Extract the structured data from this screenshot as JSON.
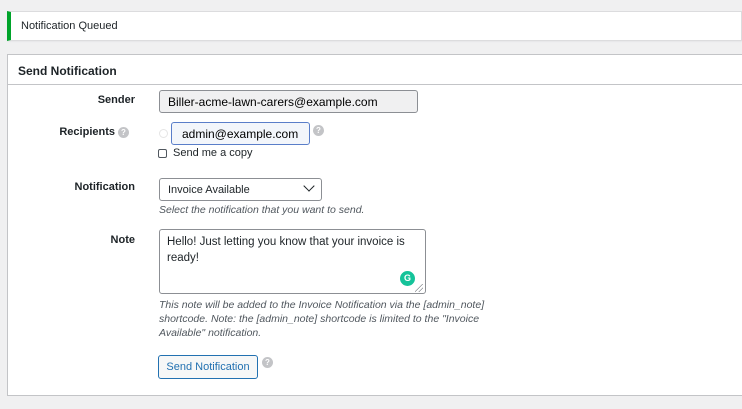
{
  "notice": {
    "text": "Notification Queued",
    "accent_color": "#00a32a"
  },
  "panel": {
    "title": "Send Notification",
    "sender": {
      "label": "Sender",
      "value": "Biller-acme-lawn-carers@example.com"
    },
    "recipients": {
      "label": "Recipients",
      "tags": [
        "admin@example.com"
      ],
      "copy_label": "Send me a copy",
      "copy_checked": false
    },
    "notification": {
      "label": "Notification",
      "selected": "Invoice Available",
      "description": "Select the notification that you want to send."
    },
    "note": {
      "label": "Note",
      "value": "Hello!  Just letting you know that your invoice is ready!",
      "description_lines": [
        "This note will be added to the Invoice Notification via the [admin_note]",
        "shortcode. Note: the [admin_note] shortcode is limited to the \"Invoice",
        "Available\" notification."
      ]
    },
    "submit_label": "Send Notification"
  },
  "icons": [
    "help-icon",
    "chevron-down-icon",
    "grammarly-icon"
  ],
  "colors": {
    "primary": "#2271b1",
    "background": "#f0f0f1",
    "grammarly": "#15c39a"
  }
}
